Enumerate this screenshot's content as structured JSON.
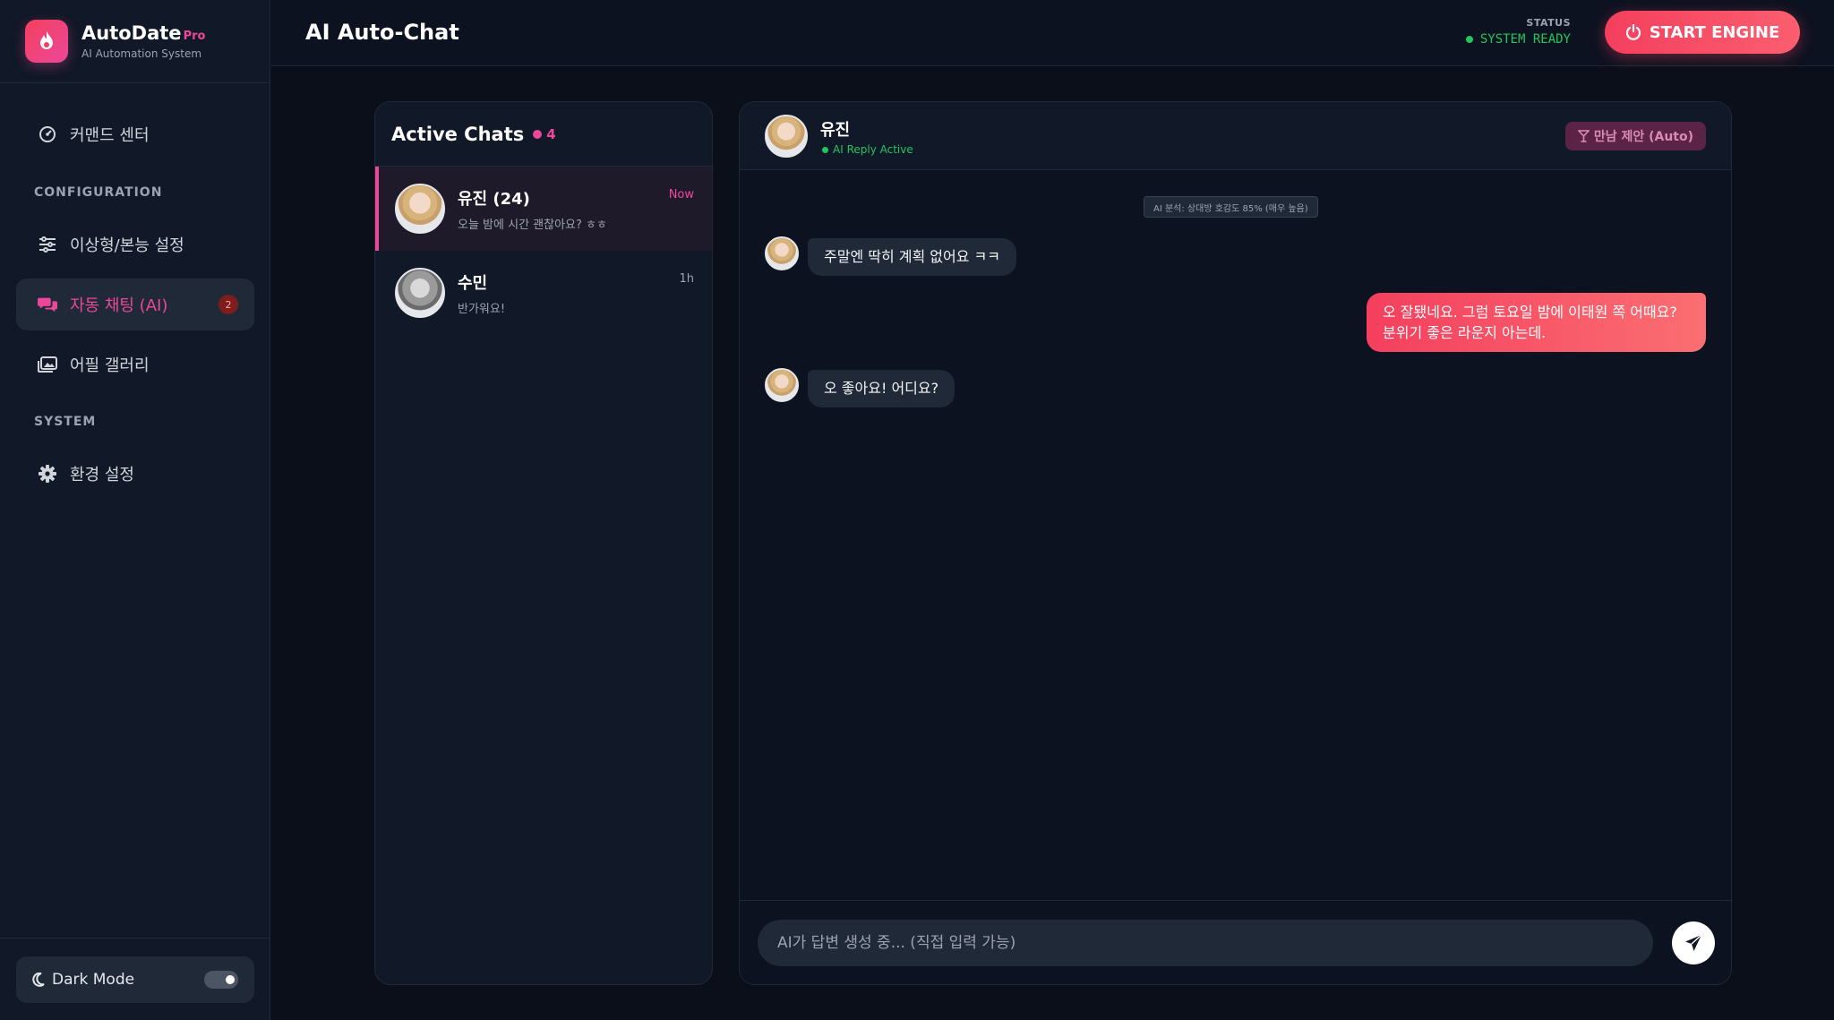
{
  "brand": {
    "name": "AutoDate",
    "tier": "Pro",
    "subtitle": "AI Automation System",
    "accent": "#ec4899"
  },
  "sidebar": {
    "items": [
      {
        "label": "커맨드 센터",
        "icon": "dashboard-icon"
      },
      {
        "label": "이상형/본능 설정",
        "icon": "sliders-icon"
      },
      {
        "label": "자동 채팅 (AI)",
        "icon": "chat-bubbles-icon",
        "active": true,
        "badge": "2"
      },
      {
        "label": "어필 갤러리",
        "icon": "gallery-icon"
      },
      {
        "label": "환경 설정",
        "icon": "gear-icon"
      }
    ],
    "sections": [
      "CONFIGURATION",
      "SYSTEM"
    ],
    "dark_mode_label": "Dark Mode",
    "dark_mode_on": true
  },
  "header": {
    "title": "AI Auto-Chat",
    "status_label": "STATUS",
    "status_value": "SYSTEM READY",
    "status_color": "#22c55e",
    "engine_button": "START ENGINE"
  },
  "chats": {
    "title": "Active Chats",
    "count": "4",
    "items": [
      {
        "name": "유진 (24)",
        "preview": "오늘 밤에 시간 괜찮아요? ㅎㅎ",
        "time": "Now",
        "active": true
      },
      {
        "name": "수민",
        "preview": "반가워요!",
        "time": "1h",
        "active": false
      }
    ]
  },
  "conversation": {
    "name": "유진",
    "status": "AI Reply Active",
    "meet_button": "만남 제안 (Auto)",
    "ai_note": "AI 분석: 상대방 호감도 85% (매우 높음)",
    "messages": [
      {
        "from": "them",
        "text": "주말엔 딱히 계획 없어요 ㅋㅋ"
      },
      {
        "from": "me",
        "text": "오 잘됐네요. 그럼 토요일 밤에 이태원 쪽 어때요? 분위기 좋은 라운지 아는데."
      },
      {
        "from": "them",
        "text": "오 좋아요! 어디요?"
      }
    ],
    "input_placeholder": "AI가 답변 생성 중... (직접 입력 가능)"
  }
}
